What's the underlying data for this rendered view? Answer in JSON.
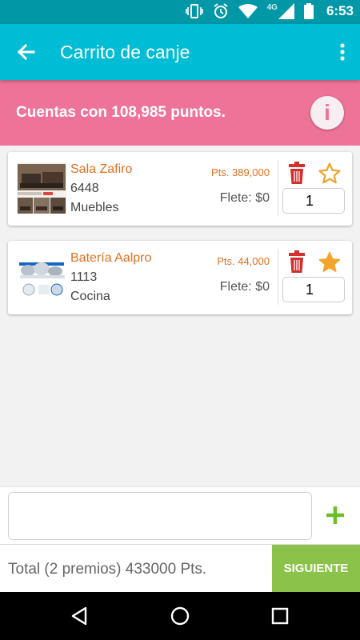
{
  "status": {
    "network": "4G",
    "time": "6:53",
    "icons": [
      "vibrate-icon",
      "alarm-icon",
      "wifi-icon",
      "signal-icon",
      "battery-icon"
    ]
  },
  "appbar": {
    "title": "Carrito de canje",
    "back_icon": "arrow-back-icon",
    "menu_icon": "more-vert-icon"
  },
  "banner": {
    "text": "Cuentas con 108,985 puntos.",
    "info_label": "i"
  },
  "cart": {
    "items": [
      {
        "name": "Sala Zafiro",
        "code": "6448",
        "category": "Muebles",
        "points": "Pts. 389,000",
        "shipping": "Flete: $0",
        "quantity": "1",
        "favorite": false
      },
      {
        "name": "Batería Aalpro",
        "code": "1113",
        "category": "Cocina",
        "points": "Pts. 44,000",
        "shipping": "Flete: $0",
        "quantity": "1",
        "favorite": true
      }
    ]
  },
  "comment": {
    "value": ""
  },
  "footer": {
    "total": "Total (2 premios) 433000 Pts.",
    "next_label": "SIGUIENTE"
  },
  "colors": {
    "status_bar": "#0097a7",
    "app_bar": "#00bcd4",
    "banner": "#ee7399",
    "accent_orange": "#e07020",
    "trash_red": "#d32f2f",
    "star": "#f2a52c",
    "next_green": "#8bc34a",
    "add_green": "#6dbf2a"
  }
}
